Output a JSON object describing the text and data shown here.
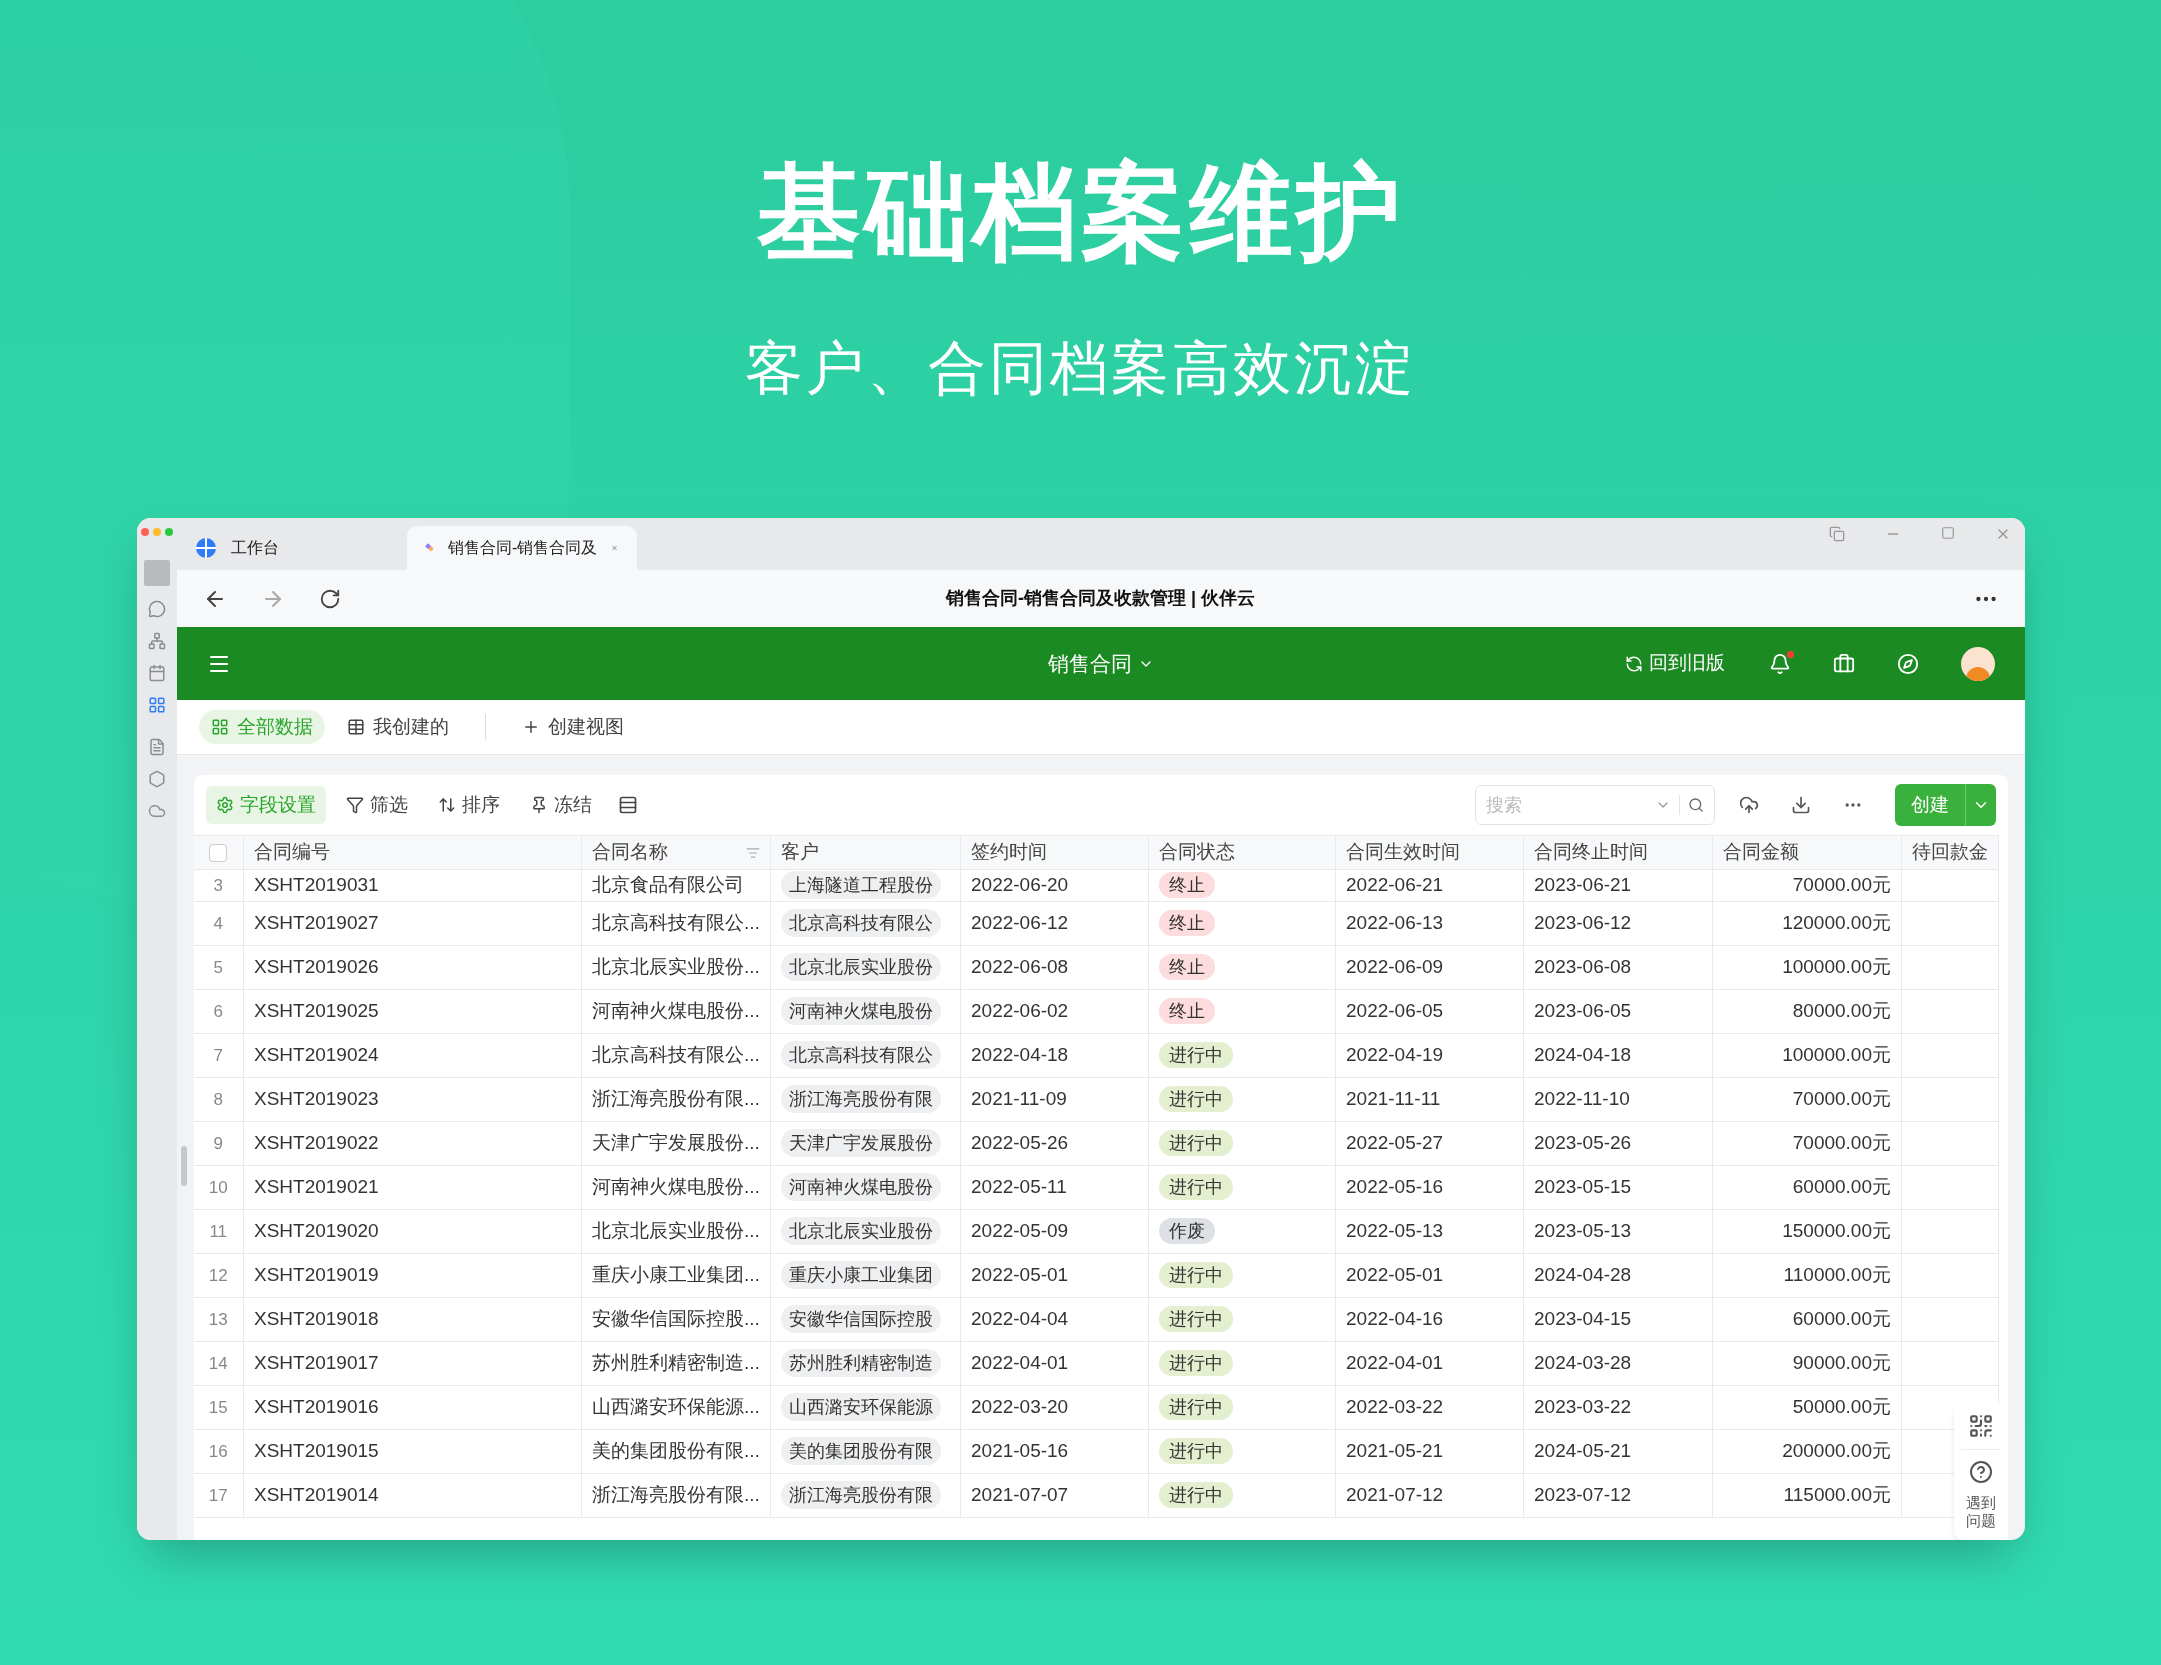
{
  "hero": {
    "title": "基础档案维护",
    "subtitle": "客户、合同档案高效沉淀"
  },
  "browser": {
    "tabs": [
      {
        "label": "工作台",
        "selected": false,
        "kind": "workbench"
      },
      {
        "label": "销售合同-销售合同及",
        "selected": true,
        "kind": "app"
      }
    ],
    "page_title": "销售合同-销售合同及收款管理 | 伙伴云"
  },
  "app_header": {
    "title": "销售合同",
    "old_version_label": "回到旧版",
    "notification": true
  },
  "views": [
    {
      "label": "全部数据",
      "selected": true,
      "kind": "grid"
    },
    {
      "label": "我创建的",
      "selected": false,
      "kind": "table"
    },
    {
      "label": "创建视图",
      "selected": false,
      "kind": "create"
    }
  ],
  "toolbar": {
    "items": [
      {
        "label": "字段设置",
        "selected": true,
        "kind": "fields"
      },
      {
        "label": "筛选",
        "selected": false,
        "kind": "filter"
      },
      {
        "label": "排序",
        "selected": false,
        "kind": "sort"
      },
      {
        "label": "冻结",
        "selected": false,
        "kind": "freeze"
      }
    ],
    "search": {
      "placeholder": "搜索"
    },
    "create_label": "创建"
  },
  "table": {
    "select_all_checked": false,
    "columns": [
      "合同编号",
      "合同名称",
      "客户",
      "签约时间",
      "合同状态",
      "合同生效时间",
      "合同终止时间",
      "合同金额",
      "待回款金"
    ],
    "rows": [
      {
        "number": "3",
        "contract_no": "XSHT2019031",
        "name": "北京食品有限公司",
        "customer": "上海隧道工程股份",
        "signed": "2022-06-20",
        "status": {
          "text": "终止",
          "kind": "terminated"
        },
        "effective": "2022-06-21",
        "end": "2023-06-21",
        "amount": "70000.00元"
      },
      {
        "number": "4",
        "contract_no": "XSHT2019027",
        "name": "北京高科技有限公...",
        "customer": "北京高科技有限公",
        "signed": "2022-06-12",
        "status": {
          "text": "终止",
          "kind": "terminated"
        },
        "effective": "2022-06-13",
        "end": "2023-06-12",
        "amount": "120000.00元"
      },
      {
        "number": "5",
        "contract_no": "XSHT2019026",
        "name": "北京北辰实业股份...",
        "customer": "北京北辰实业股份",
        "signed": "2022-06-08",
        "status": {
          "text": "终止",
          "kind": "terminated"
        },
        "effective": "2022-06-09",
        "end": "2023-06-08",
        "amount": "100000.00元"
      },
      {
        "number": "6",
        "contract_no": "XSHT2019025",
        "name": "河南神火煤电股份...",
        "customer": "河南神火煤电股份",
        "signed": "2022-06-02",
        "status": {
          "text": "终止",
          "kind": "terminated"
        },
        "effective": "2022-06-05",
        "end": "2023-06-05",
        "amount": "80000.00元"
      },
      {
        "number": "7",
        "contract_no": "XSHT2019024",
        "name": "北京高科技有限公...",
        "customer": "北京高科技有限公",
        "signed": "2022-04-18",
        "status": {
          "text": "进行中",
          "kind": "active"
        },
        "effective": "2022-04-19",
        "end": "2024-04-18",
        "amount": "100000.00元"
      },
      {
        "number": "8",
        "contract_no": "XSHT2019023",
        "name": "浙江海亮股份有限...",
        "customer": "浙江海亮股份有限",
        "signed": "2021-11-09",
        "status": {
          "text": "进行中",
          "kind": "active"
        },
        "effective": "2021-11-11",
        "end": "2022-11-10",
        "amount": "70000.00元"
      },
      {
        "number": "9",
        "contract_no": "XSHT2019022",
        "name": "天津广宇发展股份...",
        "customer": "天津广宇发展股份",
        "signed": "2022-05-26",
        "status": {
          "text": "进行中",
          "kind": "active"
        },
        "effective": "2022-05-27",
        "end": "2023-05-26",
        "amount": "70000.00元"
      },
      {
        "number": "10",
        "contract_no": "XSHT2019021",
        "name": "河南神火煤电股份...",
        "customer": "河南神火煤电股份",
        "signed": "2022-05-11",
        "status": {
          "text": "进行中",
          "kind": "active"
        },
        "effective": "2022-05-16",
        "end": "2023-05-15",
        "amount": "60000.00元"
      },
      {
        "number": "11",
        "contract_no": "XSHT2019020",
        "name": "北京北辰实业股份...",
        "customer": "北京北辰实业股份",
        "signed": "2022-05-09",
        "status": {
          "text": "作废",
          "kind": "void"
        },
        "effective": "2022-05-13",
        "end": "2023-05-13",
        "amount": "150000.00元"
      },
      {
        "number": "12",
        "contract_no": "XSHT2019019",
        "name": "重庆小康工业集团...",
        "customer": "重庆小康工业集团",
        "signed": "2022-05-01",
        "status": {
          "text": "进行中",
          "kind": "active"
        },
        "effective": "2022-05-01",
        "end": "2024-04-28",
        "amount": "110000.00元"
      },
      {
        "number": "13",
        "contract_no": "XSHT2019018",
        "name": "安徽华信国际控股...",
        "customer": "安徽华信国际控股",
        "signed": "2022-04-04",
        "status": {
          "text": "进行中",
          "kind": "active"
        },
        "effective": "2022-04-16",
        "end": "2023-04-15",
        "amount": "60000.00元"
      },
      {
        "number": "14",
        "contract_no": "XSHT2019017",
        "name": "苏州胜利精密制造...",
        "customer": "苏州胜利精密制造",
        "signed": "2022-04-01",
        "status": {
          "text": "进行中",
          "kind": "active"
        },
        "effective": "2022-04-01",
        "end": "2024-03-28",
        "amount": "90000.00元"
      },
      {
        "number": "15",
        "contract_no": "XSHT2019016",
        "name": "山西潞安环保能源...",
        "customer": "山西潞安环保能源",
        "signed": "2022-03-20",
        "status": {
          "text": "进行中",
          "kind": "active"
        },
        "effective": "2022-03-22",
        "end": "2023-03-22",
        "amount": "50000.00元"
      },
      {
        "number": "16",
        "contract_no": "XSHT2019015",
        "name": "美的集团股份有限...",
        "customer": "美的集团股份有限",
        "signed": "2021-05-16",
        "status": {
          "text": "进行中",
          "kind": "active"
        },
        "effective": "2021-05-21",
        "end": "2024-05-21",
        "amount": "200000.00元"
      },
      {
        "number": "17",
        "contract_no": "XSHT2019014",
        "name": "浙江海亮股份有限...",
        "customer": "浙江海亮股份有限",
        "signed": "2021-07-07",
        "status": {
          "text": "进行中",
          "kind": "active"
        },
        "effective": "2021-07-12",
        "end": "2023-07-12",
        "amount": "115000.00元"
      }
    ]
  },
  "help": {
    "label": "遇到问题"
  }
}
